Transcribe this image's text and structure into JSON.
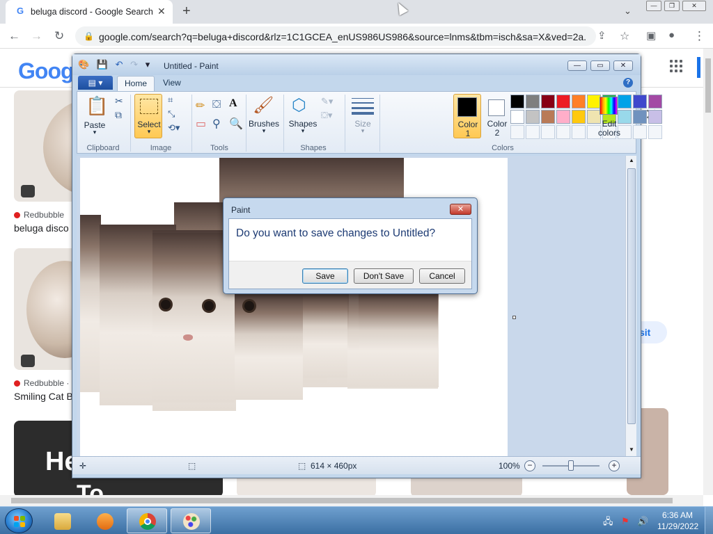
{
  "browser": {
    "tab_title": "beluga discord - Google Search",
    "tab_favicon": "G",
    "tab_close": "✕",
    "new_tab": "+",
    "url": "google.com/search?q=beluga+discord&rlz=1C1GCEA_enUS986US986&source=lnms&tbm=isch&sa=X&ved=2a...",
    "back_icon": "back-arrow-icon",
    "forward_icon": "forward-arrow-icon",
    "reload_icon": "reload-icon"
  },
  "google_page": {
    "logo": "Google",
    "results": [
      {
        "source": "Redbubble",
        "title": "beluga disco"
      },
      {
        "source": "Redbubble ·",
        "title": "Smiling Cat B"
      }
    ],
    "banner_text": "He",
    "banner_text2": "To",
    "visit_label": "sit",
    "close_glyph": "✕"
  },
  "paint": {
    "title": "Untitled - Paint",
    "tabs": {
      "home": "Home",
      "view": "View"
    },
    "help": "?",
    "groups": {
      "clipboard": "Clipboard",
      "image": "Image",
      "tools": "Tools",
      "shapes": "Shapes",
      "colors": "Colors"
    },
    "buttons": {
      "paste": "Paste",
      "select": "Select",
      "brushes": "Brushes",
      "shapes": "Shapes",
      "size": "Size",
      "color1": "Color",
      "color1_num": "1",
      "color2": "Color",
      "color2_num": "2",
      "edit_colors_1": "Edit",
      "edit_colors_2": "colors"
    },
    "color1": "#000000",
    "color2": "#ffffff",
    "palette": [
      "#000000",
      "#7f7f7f",
      "#880015",
      "#ed1c24",
      "#ff7f27",
      "#fff200",
      "#22b14c",
      "#00a2e8",
      "#3f48cc",
      "#a349a4",
      "#ffffff",
      "#c3c3c3",
      "#b97a57",
      "#ffaec9",
      "#ffc90e",
      "#efe4b0",
      "#b5e61d",
      "#99d9ea",
      "#7092be",
      "#c8bfe7"
    ],
    "status": {
      "dimensions": "614 × 460px",
      "zoom": "100%"
    }
  },
  "dialog": {
    "title": "Paint",
    "message": "Do you want to save changes to Untitled?",
    "save": "Save",
    "dont_save": "Don't Save",
    "cancel": "Cancel"
  },
  "taskbar": {
    "clock_time": "6:36 AM",
    "clock_date": "11/29/2022"
  }
}
